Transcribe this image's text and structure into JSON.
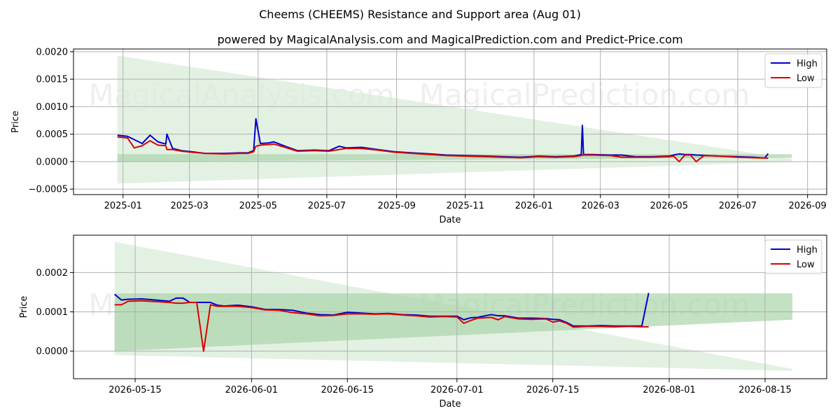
{
  "figure": {
    "title": "Cheems (CHEEMS) Resistance and Support area (Aug 01)",
    "subtitle": "powered by MagicalAnalysis.com and MagicalPrediction.com and Predict-Price.com",
    "watermarks": [
      "MagicalAnalysis.com",
      "MagicalPrediction.com"
    ]
  },
  "colors": {
    "high": "#0000cc",
    "low": "#dd0000",
    "band_light": "#d9ecd9",
    "band_dark": "#a9d4a9"
  },
  "chart_data": [
    {
      "type": "line",
      "name": "full-history",
      "xlabel": "Date",
      "ylabel": "Price",
      "x_ticks": [
        "2025-01",
        "2025-03",
        "2025-05",
        "2025-07",
        "2025-09",
        "2025-11",
        "2026-01",
        "2026-03",
        "2026-05",
        "2026-07",
        "2026-09"
      ],
      "y_ticks": [
        "−0.0005",
        "0.0000",
        "0.0005",
        "0.0010",
        "0.0015",
        "0.0020"
      ],
      "legend": {
        "position": "top-right",
        "entries": [
          "High",
          "Low"
        ]
      },
      "grid": true,
      "xlim": [
        "2024-11-18",
        "2026-09-18"
      ],
      "ylim": [
        -0.0006,
        0.00205
      ],
      "x": [
        "2024-12-27",
        "2025-01-05",
        "2025-01-11",
        "2025-01-18",
        "2025-01-25",
        "2025-02-01",
        "2025-02-08",
        "2025-02-09",
        "2025-02-14",
        "2025-02-22",
        "2025-03-03",
        "2025-03-15",
        "2025-04-01",
        "2025-04-15",
        "2025-04-22",
        "2025-04-27",
        "2025-04-29",
        "2025-05-03",
        "2025-05-10",
        "2025-05-15",
        "2025-05-25",
        "2025-06-05",
        "2025-06-20",
        "2025-07-03",
        "2025-07-12",
        "2025-07-18",
        "2025-08-01",
        "2025-08-15",
        "2025-08-30",
        "2025-09-15",
        "2025-10-01",
        "2025-10-15",
        "2025-11-01",
        "2025-11-20",
        "2025-12-05",
        "2025-12-20",
        "2026-01-05",
        "2026-01-20",
        "2026-02-05",
        "2026-02-12",
        "2026-02-13",
        "2026-02-14",
        "2026-02-22",
        "2026-03-10",
        "2026-03-20",
        "2026-04-01",
        "2026-04-15",
        "2026-05-01",
        "2026-05-05",
        "2026-05-10",
        "2026-05-15",
        "2026-05-20",
        "2026-05-25",
        "2026-06-01",
        "2026-06-15",
        "2026-07-01",
        "2026-07-15",
        "2026-07-25",
        "2026-07-28"
      ],
      "series": [
        {
          "name": "High",
          "values": [
            0.00048,
            0.00046,
            0.0004,
            0.00033,
            0.00048,
            0.00036,
            0.00032,
            0.0005,
            0.00024,
            0.0002,
            0.00018,
            0.00015,
            0.00015,
            0.00016,
            0.00016,
            0.0002,
            0.00078,
            0.00033,
            0.00034,
            0.00036,
            0.00028,
            0.0002,
            0.00021,
            0.0002,
            0.00028,
            0.00025,
            0.00026,
            0.00022,
            0.00018,
            0.00016,
            0.00014,
            0.00012,
            0.00011,
            0.0001,
            9e-05,
            8e-05,
            0.0001,
            9e-05,
            0.0001,
            0.00013,
            0.00066,
            0.00013,
            0.00013,
            0.00012,
            0.00012,
            9e-05,
            9e-05,
            0.0001,
            0.00012,
            0.00014,
            0.00013,
            0.00013,
            0.00012,
            0.000115,
            0.0001,
            9e-05,
            8e-05,
            6.5e-05,
            0.000145
          ]
        },
        {
          "name": "Low",
          "values": [
            0.00045,
            0.00043,
            0.00025,
            0.00029,
            0.00038,
            0.0003,
            0.00029,
            0.00022,
            0.00022,
            0.00019,
            0.00017,
            0.00015,
            0.00014,
            0.00015,
            0.00015,
            0.00018,
            0.00028,
            0.0003,
            0.00031,
            0.00032,
            0.00026,
            0.00019,
            0.0002,
            0.00019,
            0.00022,
            0.00024,
            0.00024,
            0.00021,
            0.00017,
            0.00015,
            0.00013,
            0.00011,
            0.0001,
            9e-05,
            8e-05,
            7e-05,
            9e-05,
            8e-05,
            9e-05,
            0.00011,
            0.00012,
            0.00012,
            0.00012,
            0.00011,
            8e-05,
            8e-05,
            8e-05,
            9e-05,
            0.0001,
            0.0,
            0.00012,
            0.00012,
            0.0,
            0.00011,
            0.0001,
            8e-05,
            7e-05,
            6.5e-05,
            6.2e-05
          ]
        }
      ],
      "bands": {
        "light": {
          "x": [
            "2024-12-27",
            "2026-08-18"
          ],
          "upper": [
            0.00193,
            5e-05
          ],
          "lower": [
            -0.0004,
            -5e-06
          ]
        },
        "dark": {
          "x": [
            "2024-12-27",
            "2026-08-18"
          ],
          "upper": [
            0.000135,
            0.000135
          ],
          "lower": [
            0.0,
            7e-05
          ]
        }
      }
    },
    {
      "type": "line",
      "name": "recent-zoom",
      "xlabel": "Date",
      "ylabel": "Price",
      "x_ticks": [
        "2026-05-15",
        "2026-06-01",
        "2026-06-15",
        "2026-07-01",
        "2026-07-15",
        "2026-08-01",
        "2026-08-15"
      ],
      "y_ticks": [
        "0.0000",
        "0.0001",
        "0.0002"
      ],
      "legend": {
        "position": "top-right",
        "entries": [
          "High",
          "Low"
        ]
      },
      "grid": true,
      "xlim": [
        "2026-05-06",
        "2026-08-24"
      ],
      "ylim": [
        -7e-05,
        0.000295
      ],
      "x": [
        "2026-05-12",
        "2026-05-13",
        "2026-05-14",
        "2026-05-16",
        "2026-05-18",
        "2026-05-20",
        "2026-05-21",
        "2026-05-22",
        "2026-05-23",
        "2026-05-24",
        "2026-05-25",
        "2026-05-26",
        "2026-05-27",
        "2026-05-28",
        "2026-05-30",
        "2026-06-01",
        "2026-06-03",
        "2026-06-05",
        "2026-06-07",
        "2026-06-09",
        "2026-06-11",
        "2026-06-13",
        "2026-06-15",
        "2026-06-17",
        "2026-06-19",
        "2026-06-21",
        "2026-06-23",
        "2026-06-25",
        "2026-06-27",
        "2026-06-29",
        "2026-07-01",
        "2026-07-02",
        "2026-07-03",
        "2026-07-04",
        "2026-07-06",
        "2026-07-07",
        "2026-07-08",
        "2026-07-10",
        "2026-07-12",
        "2026-07-14",
        "2026-07-15",
        "2026-07-16",
        "2026-07-17",
        "2026-07-18",
        "2026-07-20",
        "2026-07-22",
        "2026-07-24",
        "2026-07-26",
        "2026-07-28",
        "2026-07-29"
      ],
      "series": [
        {
          "name": "High",
          "values": [
            0.000145,
            0.00013,
            0.000132,
            0.000133,
            0.00013,
            0.000127,
            0.000135,
            0.000135,
            0.000124,
            0.000124,
            0.000124,
            0.000124,
            0.000117,
            0.000115,
            0.000117,
            0.000113,
            0.000106,
            0.000106,
            0.000104,
            9.7e-05,
            9.3e-05,
            9.2e-05,
            9.9e-05,
            9.7e-05,
            9.5e-05,
            9.6e-05,
            9.3e-05,
            9.2e-05,
            8.9e-05,
            8.9e-05,
            8.9e-05,
            8e-05,
            8.5e-05,
            8.6e-05,
            9.3e-05,
            9e-05,
            9e-05,
            8.4e-05,
            8.4e-05,
            8.3e-05,
            8.1e-05,
            8e-05,
            7.3e-05,
            6.4e-05,
            6.4e-05,
            6.5e-05,
            6.4e-05,
            6.4e-05,
            6.4e-05,
            0.000148
          ]
        },
        {
          "name": "Low",
          "values": [
            0.000118,
            0.000118,
            0.000127,
            0.000128,
            0.000126,
            0.000124,
            0.000122,
            0.000122,
            0.000124,
            0.000124,
            0.0,
            0.000118,
            0.000114,
            0.000114,
            0.000114,
            0.000111,
            0.000105,
            0.000104,
            9.8e-05,
            9.5e-05,
            9e-05,
            9.1e-05,
            9.5e-05,
            9.5e-05,
            9.4e-05,
            9.5e-05,
            9.2e-05,
            9e-05,
            8.7e-05,
            8.8e-05,
            8.7e-05,
            7.1e-05,
            7.8e-05,
            8.4e-05,
            8.6e-05,
            8e-05,
            8.8e-05,
            8.2e-05,
            8.1e-05,
            8.2e-05,
            7.4e-05,
            7.7e-05,
            7.1e-05,
            6.1e-05,
            6.3e-05,
            6.3e-05,
            6.2e-05,
            6.3e-05,
            6.2e-05,
            6.2e-05
          ]
        }
      ],
      "bands": {
        "light": {
          "x": [
            "2026-05-12",
            "2026-08-19"
          ],
          "upper": [
            0.000278,
            -4.5e-05
          ],
          "lower": [
            -1e-05,
            -5e-05
          ]
        },
        "dark": {
          "x": [
            "2026-05-12",
            "2026-08-19"
          ],
          "upper": [
            0.000147,
            0.000147
          ],
          "lower": [
            0.0,
            8e-05
          ]
        }
      }
    }
  ]
}
